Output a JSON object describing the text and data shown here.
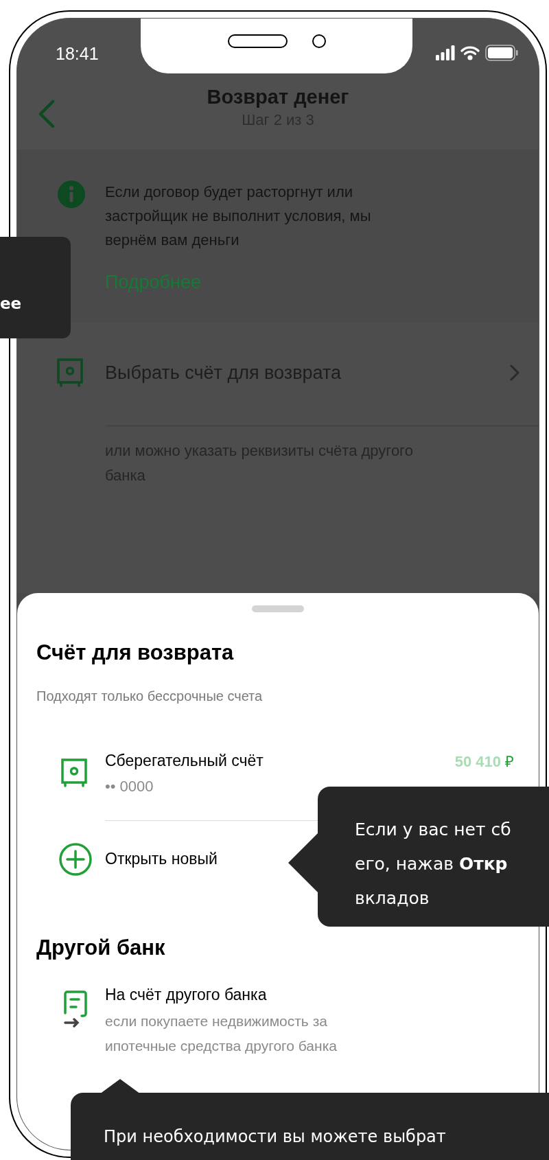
{
  "status_bar": {
    "time": "18:41"
  },
  "header": {
    "title": "Возврат денег",
    "subtitle": "Шаг 2 из 3"
  },
  "info": {
    "text": "Если договор будет расторгнут или застройщик не выполнит условия, мы вернём вам деньги",
    "link": "Подробнее"
  },
  "select_account": {
    "label": "Выбрать счёт для возврата",
    "hint": "или можно указать реквизиты счёта другого банка"
  },
  "sheet": {
    "title": "Счёт для возврата",
    "subtitle": "Подходят только бессрочные счета",
    "accounts": [
      {
        "kind": "account",
        "name": "Сберегательный счёт",
        "number": "•• 0000",
        "amount": "50 410",
        "currency": "₽"
      },
      {
        "kind": "add",
        "name": "Открыть новый"
      }
    ],
    "other_title": "Другой банк",
    "other_items": [
      {
        "name": "На счёт другого банка",
        "description": "если покупаете недвижимость за ипотечные средства другого банка"
      }
    ]
  },
  "tooltips": [
    {
      "lines": [
        "**ee**"
      ]
    },
    {
      "lines": [
        "Если у вас нет сб",
        "его, нажав **Откр**",
        "вкладов"
      ]
    },
    {
      "lines": [
        "При необходимости вы можете выбрат"
      ]
    }
  ]
}
